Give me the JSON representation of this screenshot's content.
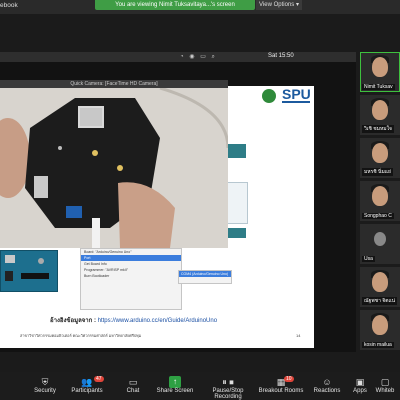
{
  "top_bar": {
    "browser_tab": "ebook",
    "share_banner": "You are viewing Nimit Tuksavitaya...'s screen",
    "view_options": "View Options ▾"
  },
  "shared_screen": {
    "menubar": {
      "clock": "Sat 15:50",
      "icons": [
        "wifi-icon",
        "battery-icon",
        "search-icon"
      ]
    },
    "quick_camera_title": "Quick Camera: [FaceTime HD Camera]",
    "slide": {
      "logo_text": "SPU",
      "dropdown_items": [
        "Board: \"Arduino/Genuino Uno\"",
        "Port",
        "Get Board Info",
        "Programmer: \"AVRISP mkII\"",
        "Burn Bootloader"
      ],
      "submenu_highlight": "COM4 (Arduino/Genuino Uno)",
      "source_label": "อ้างอิงข้อมูลจาก :",
      "source_url": "https://www.arduino.cc/en/Guide/ArduinoUno",
      "footer_text": "สาขาวิชาวิศวกรรมคอมพิวเตอร์ คณะวิศวกรรมศาสตร์ มหาวิทยาลัยศรีปทุม",
      "page_number": "14"
    }
  },
  "participants": [
    {
      "name": "Nimit Tuksav",
      "active": true
    },
    {
      "name": "วิเชิ ชมหมใจ",
      "active": false
    },
    {
      "name": "มหรชิ นิ่มแย่",
      "active": false
    },
    {
      "name": "Songphao C",
      "active": false
    },
    {
      "name": "Usa",
      "active": false
    },
    {
      "name": "ณัฐพชา จิตแน่",
      "active": false
    },
    {
      "name": "kosin mailua",
      "active": false
    }
  ],
  "toolbar": {
    "items": [
      {
        "label": "Security",
        "icon": "shield-icon"
      },
      {
        "label": "Participants",
        "icon": "people-icon",
        "badge": "47"
      },
      {
        "label": "Chat",
        "icon": "chat-icon"
      },
      {
        "label": "Share Screen",
        "icon": "share-screen-icon"
      },
      {
        "label": "Pause/Stop Recording",
        "icon": "record-icon"
      },
      {
        "label": "Breakout Rooms",
        "icon": "breakout-icon",
        "badge": "10"
      },
      {
        "label": "Reactions",
        "icon": "smile-icon"
      },
      {
        "label": "Apps",
        "icon": "apps-icon"
      },
      {
        "label": "Whiteb",
        "icon": "whiteboard-icon"
      }
    ]
  },
  "colors": {
    "share_banner": "#3f9d45",
    "active_speaker": "#3ec03e",
    "spu_blue": "#1c5a9e",
    "recording_red": "#e0453a"
  }
}
